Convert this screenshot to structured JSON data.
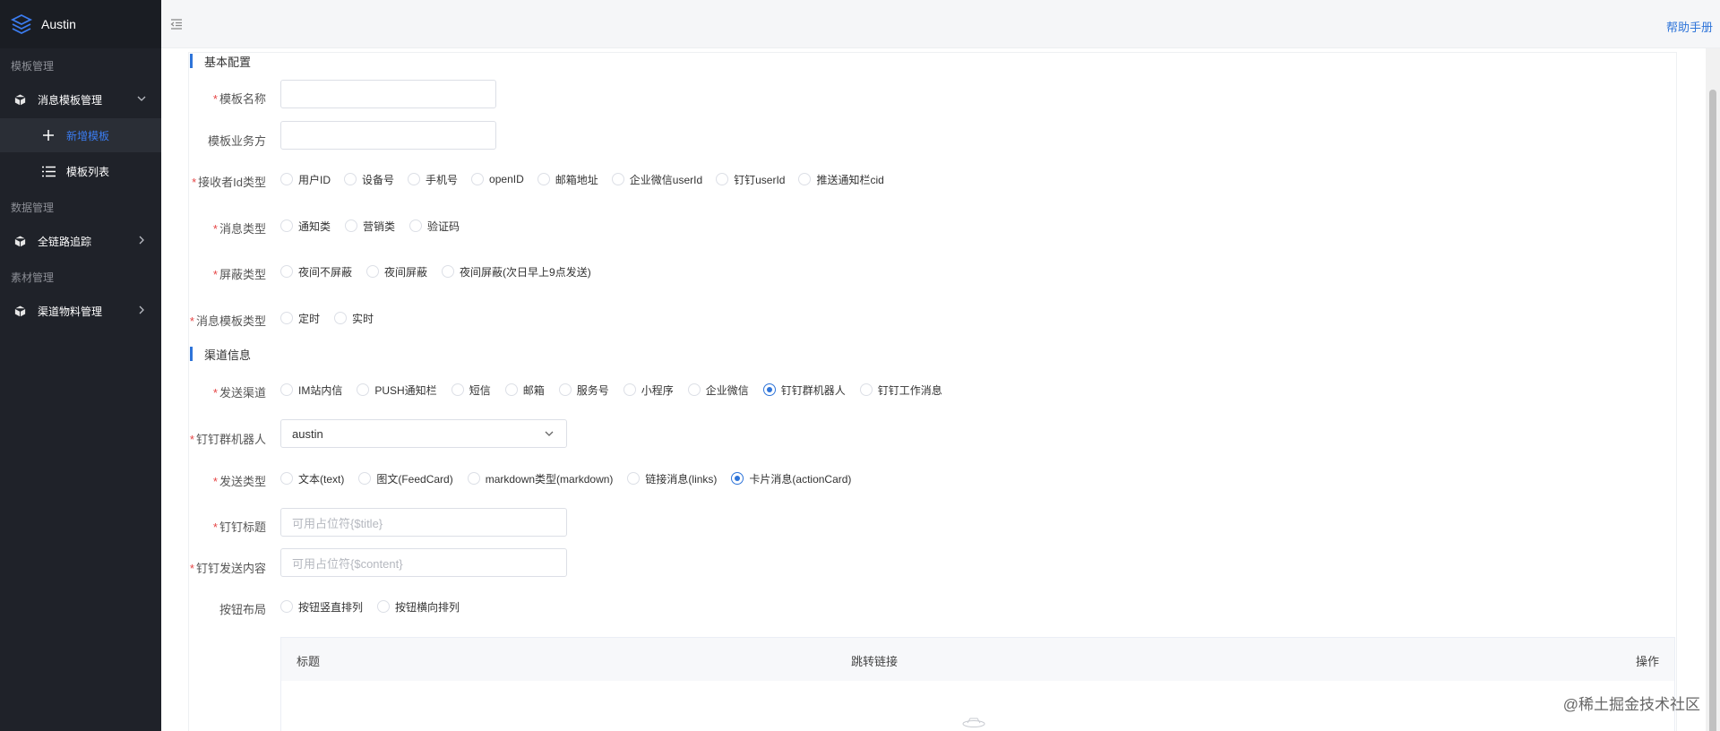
{
  "app": {
    "title": "Austin"
  },
  "sidebar": {
    "groups": [
      {
        "title": "模板管理"
      },
      {
        "title": "数据管理"
      },
      {
        "title": "素材管理"
      }
    ],
    "items": [
      {
        "label": "消息模板管理",
        "icon": "cube-icon"
      },
      {
        "label": "新增模板",
        "icon": "plus-icon"
      },
      {
        "label": "模板列表",
        "icon": "list-icon"
      },
      {
        "label": "全链路追踪",
        "icon": "cube-icon"
      },
      {
        "label": "渠道物料管理",
        "icon": "cube-icon"
      }
    ]
  },
  "topbar": {
    "help_label": "帮助手册"
  },
  "form": {
    "section_basic": "基本配置",
    "section_channel": "渠道信息",
    "template_name": {
      "label": "模板名称",
      "value": ""
    },
    "business_side": {
      "label": "模板业务方",
      "value": ""
    },
    "receiver_type": {
      "label": "接收者Id类型",
      "options": [
        "用户ID",
        "设备号",
        "手机号",
        "openID",
        "邮箱地址",
        "企业微信userId",
        "钉钉userId",
        "推送通知栏cid"
      ]
    },
    "msg_type": {
      "label": "消息类型",
      "options": [
        "通知类",
        "营销类",
        "验证码"
      ]
    },
    "shield_type": {
      "label": "屏蔽类型",
      "options": [
        "夜间不屏蔽",
        "夜间屏蔽",
        "夜间屏蔽(次日早上9点发送)"
      ]
    },
    "template_type": {
      "label": "消息模板类型",
      "options": [
        "定时",
        "实时"
      ]
    },
    "send_channel": {
      "label": "发送渠道",
      "options": [
        "IM站内信",
        "PUSH通知栏",
        "短信",
        "邮箱",
        "服务号",
        "小程序",
        "企业微信",
        "钉钉群机器人",
        "钉钉工作消息"
      ],
      "selected": "钉钉群机器人"
    },
    "robot": {
      "label": "钉钉群机器人",
      "value": "austin"
    },
    "send_type": {
      "label": "发送类型",
      "options": [
        "文本(text)",
        "图文(FeedCard)",
        "markdown类型(markdown)",
        "链接消息(links)",
        "卡片消息(actionCard)"
      ],
      "selected": "卡片消息(actionCard)"
    },
    "title": {
      "label": "钉钉标题",
      "placeholder": "可用占位符{$title}"
    },
    "content": {
      "label": "钉钉发送内容",
      "placeholder": "可用占位符{$content}"
    },
    "btn_layout": {
      "label": "按钮布局",
      "options": [
        "按钮竖直排列",
        "按钮横向排列"
      ]
    },
    "table": {
      "headers": [
        "标题",
        "跳转链接",
        "操作"
      ]
    }
  },
  "watermark": "@稀土掘金技术社区",
  "colors": {
    "accent": "#2e74d9",
    "sidebar_bg": "#1f2229",
    "required": "#e64545"
  }
}
